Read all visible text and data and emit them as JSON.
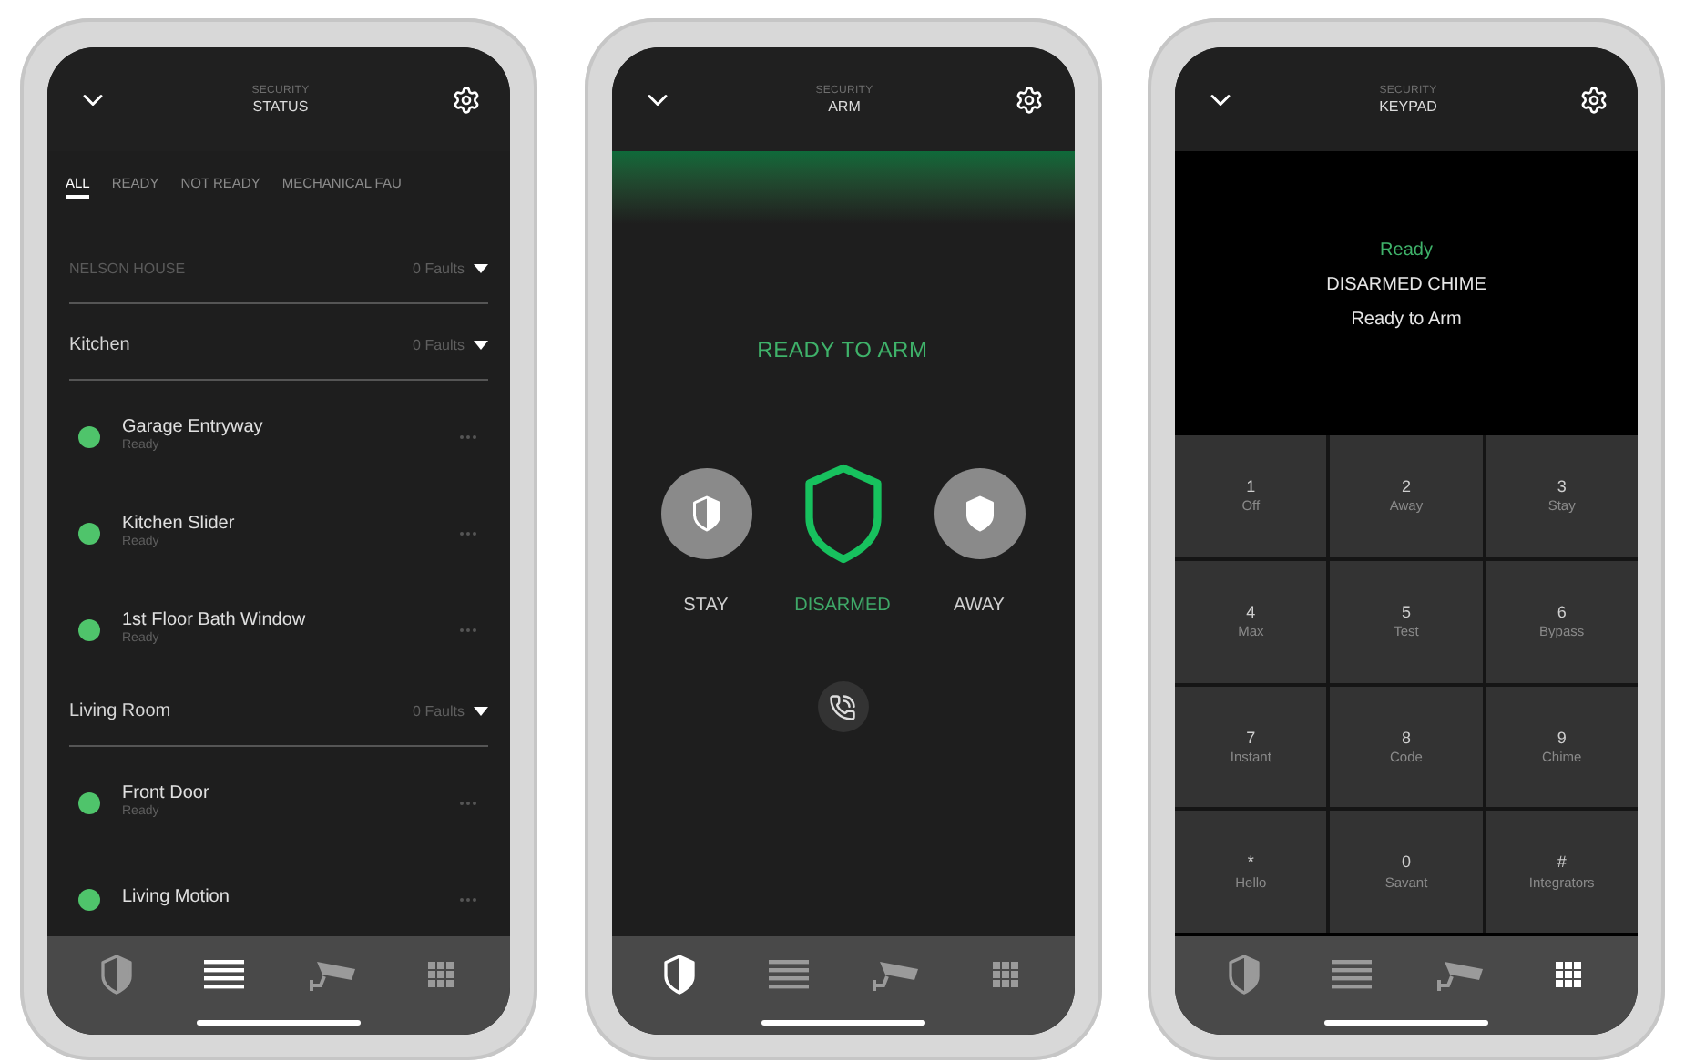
{
  "screens": [
    {
      "kind": "status",
      "header": {
        "category": "SECURITY",
        "title": "STATUS"
      },
      "filters": [
        {
          "label": "ALL",
          "selected": true
        },
        {
          "label": "READY",
          "selected": false
        },
        {
          "label": "NOT READY",
          "selected": false
        },
        {
          "label": "MECHANICAL FAU",
          "selected": false
        }
      ],
      "groups": [
        {
          "kind": "house",
          "name": "NELSON HOUSE",
          "faults": "0 Faults"
        },
        {
          "kind": "room",
          "name": "Kitchen",
          "faults": "0 Faults",
          "sensors": [
            {
              "name": "Garage Entryway",
              "status": "Ready"
            },
            {
              "name": "Kitchen Slider",
              "status": "Ready"
            },
            {
              "name": "1st Floor Bath Window",
              "status": "Ready"
            }
          ]
        },
        {
          "kind": "room",
          "name": "Living Room",
          "faults": "0 Faults",
          "sensors": [
            {
              "name": "Front Door",
              "status": "Ready"
            },
            {
              "name": "Living Motion"
            }
          ]
        }
      ],
      "nav": [
        {
          "selected": false
        },
        {
          "selected": true
        },
        {
          "selected": false
        },
        {
          "selected": false
        }
      ]
    },
    {
      "kind": "arm",
      "header": {
        "category": "SECURITY",
        "title": "ARM"
      },
      "message": "READY TO ARM",
      "modes": [
        {
          "kind": "stay",
          "label": "STAY",
          "selected": false
        },
        {
          "kind": "disarmed",
          "label": "DISARMED",
          "selected": true
        },
        {
          "kind": "away",
          "label": "AWAY",
          "selected": false
        }
      ],
      "nav": [
        {
          "selected": true
        },
        {
          "selected": false
        },
        {
          "selected": false
        },
        {
          "selected": false
        }
      ]
    },
    {
      "kind": "keypad",
      "header": {
        "category": "SECURITY",
        "title": "KEYPAD"
      },
      "display": [
        {
          "kind": "status",
          "text": "Ready"
        },
        {
          "kind": "text",
          "text": "DISARMED CHIME"
        },
        {
          "kind": "text",
          "text": "Ready to Arm"
        }
      ],
      "keys": [
        {
          "digit": "1",
          "label": "Off"
        },
        {
          "digit": "2",
          "label": "Away"
        },
        {
          "digit": "3",
          "label": "Stay"
        },
        {
          "digit": "4",
          "label": "Max"
        },
        {
          "digit": "5",
          "label": "Test"
        },
        {
          "digit": "6",
          "label": "Bypass"
        },
        {
          "digit": "7",
          "label": "Instant"
        },
        {
          "digit": "8",
          "label": "Code"
        },
        {
          "digit": "9",
          "label": "Chime"
        },
        {
          "digit": "*",
          "label": "Hello"
        },
        {
          "digit": "0",
          "label": "Savant"
        },
        {
          "digit": "#",
          "label": "Integrators"
        }
      ],
      "nav": [
        {
          "selected": false
        },
        {
          "selected": false
        },
        {
          "selected": false
        },
        {
          "selected": true
        }
      ]
    }
  ]
}
